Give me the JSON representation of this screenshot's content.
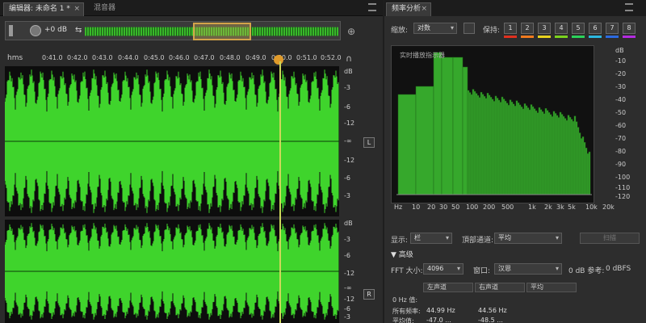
{
  "editor": {
    "tab_active": "编辑器: 未命名 1 *",
    "tab_active_close": "×",
    "tab_inactive": "混音器",
    "overview": {
      "gain_text": "+0 dB"
    },
    "ruler_unit": "hms",
    "ruler_ticks": [
      "0:41.0",
      "0:42.0",
      "0:43.0",
      "0:44.0",
      "0:45.0",
      "0:46.0",
      "0:47.0",
      "0:48.0",
      "0:49.0",
      "0:50.0",
      "0:51.0",
      "0:52.0"
    ],
    "db_scale_ch1": [
      "dB",
      "-3",
      "-6",
      "-12",
      "-∞",
      "-12",
      "-6",
      "-3"
    ],
    "db_scale_ch2": [
      "dB",
      "-3",
      "-6",
      "-12",
      "-∞",
      "-12",
      "-6",
      "-3"
    ],
    "ch1_label": "L",
    "ch2_label": "R",
    "wave_color": "#3fd42c"
  },
  "panel": {
    "tab_title": "频率分析",
    "tab_close": "×",
    "scale_label": "缩放:",
    "scale_value": "对数",
    "hold_label": "保持:",
    "hold_buttons": [
      {
        "label": "1",
        "color": "#e0301e"
      },
      {
        "label": "2",
        "color": "#f07a1e"
      },
      {
        "label": "3",
        "color": "#e8d21e"
      },
      {
        "label": "4",
        "color": "#7ad21e"
      },
      {
        "label": "5",
        "color": "#2bd25a"
      },
      {
        "label": "6",
        "color": "#2bb8e0"
      },
      {
        "label": "7",
        "color": "#2b6ae0"
      },
      {
        "label": "8",
        "color": "#b42be0"
      }
    ],
    "spectrum_title": "实时播放指示器",
    "spectrum_fill": "#36a82c",
    "db_ticks": [
      "dB",
      "-10",
      "-20",
      "-30",
      "-40",
      "-50",
      "-60",
      "-70",
      "-80",
      "-90",
      "-100",
      "-110",
      "-120"
    ],
    "hz_ticks": [
      "Hz",
      "10",
      "20",
      "30",
      "50",
      "100",
      "200",
      "500",
      "1k",
      "2k",
      "3k",
      "5k",
      "10k",
      "20k"
    ],
    "display_label": "显示:",
    "display_value": "栏",
    "channel_label": "頂部通道:",
    "channel_value": "平均",
    "scan_button": "扫描",
    "advanced_label": "▼  高级",
    "fft_label": "FFT 大小:",
    "fft_value": "4096",
    "window_label": "窗口:",
    "window_value": "汉恩",
    "ref_label": "0 dB 参考:",
    "ref_value": "0 dBFS",
    "table": {
      "headers": [
        "左声道",
        "右声道",
        "平均"
      ],
      "rows": [
        {
          "label": "0 Hz 值:",
          "values": [
            "",
            "",
            ""
          ]
        },
        {
          "label": "所有频率:",
          "values": [
            "44.99 Hz",
            "44.56 Hz",
            ""
          ]
        },
        {
          "label": "平均值:",
          "values": [
            "-47.0 ...",
            "-48.5 ...",
            ""
          ]
        }
      ]
    }
  }
}
